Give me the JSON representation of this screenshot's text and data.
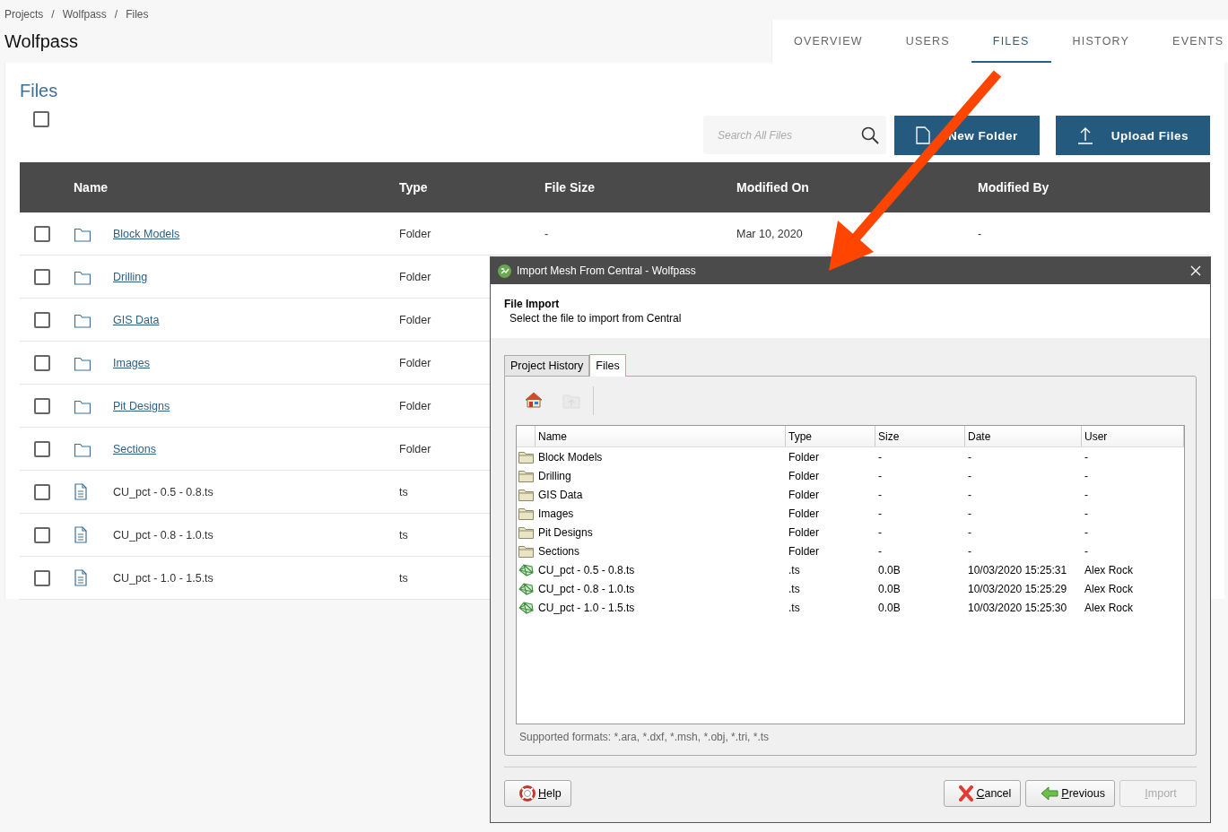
{
  "breadcrumb": {
    "items": [
      "Projects",
      "Wolfpass",
      "Files"
    ],
    "separators": [
      "/",
      "/"
    ]
  },
  "project_title": "Wolfpass",
  "tabs": [
    {
      "label": "OVERVIEW",
      "selected": false
    },
    {
      "label": "USERS",
      "selected": false
    },
    {
      "label": "FILES",
      "selected": true
    },
    {
      "label": "HISTORY",
      "selected": false
    },
    {
      "label": "EVENTS",
      "selected": false
    }
  ],
  "files_panel": {
    "title": "Files",
    "select_all": {
      "checked": false
    },
    "search": {
      "placeholder": "Search All Files"
    },
    "buttons": [
      {
        "label": "New Folder",
        "kind": "new-folder"
      },
      {
        "label": "Upload Files",
        "kind": "upload"
      }
    ],
    "table": {
      "columns": [
        "Name",
        "Type",
        "File Size",
        "Modified On",
        "Modified By"
      ],
      "rows": [
        {
          "checked": false,
          "kind": "folder",
          "name": "Block Models",
          "type": "Folder",
          "file_size": "-",
          "modified_on": "Mar 10, 2020",
          "modified_by": "-"
        },
        {
          "checked": false,
          "kind": "folder",
          "name": "Drilling",
          "type": "Folder"
        },
        {
          "checked": false,
          "kind": "folder",
          "name": "GIS Data",
          "type": "Folder"
        },
        {
          "checked": false,
          "kind": "folder",
          "name": "Images",
          "type": "Folder"
        },
        {
          "checked": false,
          "kind": "folder",
          "name": "Pit Designs",
          "type": "Folder"
        },
        {
          "checked": false,
          "kind": "folder",
          "name": "Sections",
          "type": "Folder"
        },
        {
          "checked": false,
          "kind": "file",
          "name": "CU_pct - 0.5 - 0.8.ts",
          "type": "ts"
        },
        {
          "checked": false,
          "kind": "file",
          "name": "CU_pct - 0.8 - 1.0.ts",
          "type": "ts"
        },
        {
          "checked": false,
          "kind": "file",
          "name": "CU_pct - 1.0 - 1.5.ts",
          "type": "ts"
        }
      ]
    }
  },
  "dialog": {
    "title": "Import Mesh From Central - Wolfpass",
    "heading": "File Import",
    "subtitle": "Select the file to import from Central",
    "tabs": [
      {
        "label": "Project History",
        "selected": false
      },
      {
        "label": "Files",
        "selected": true
      }
    ],
    "toolbar": [
      {
        "kind": "home",
        "disabled": false
      },
      {
        "kind": "up",
        "disabled": true
      }
    ],
    "list": {
      "columns": [
        "Name",
        "Type",
        "Size",
        "Date",
        "User"
      ],
      "rows": [
        {
          "kind": "folder",
          "name": "Block Models",
          "type": "Folder",
          "size": "-",
          "date": "-",
          "user": "-"
        },
        {
          "kind": "folder",
          "name": "Drilling",
          "type": "Folder",
          "size": "-",
          "date": "-",
          "user": "-"
        },
        {
          "kind": "folder",
          "name": "GIS Data",
          "type": "Folder",
          "size": "-",
          "date": "-",
          "user": "-"
        },
        {
          "kind": "folder",
          "name": "Images",
          "type": "Folder",
          "size": "-",
          "date": "-",
          "user": "-"
        },
        {
          "kind": "folder",
          "name": "Pit Designs",
          "type": "Folder",
          "size": "-",
          "date": "-",
          "user": "-"
        },
        {
          "kind": "folder",
          "name": "Sections",
          "type": "Folder",
          "size": "-",
          "date": "-",
          "user": "-"
        },
        {
          "kind": "mesh",
          "name": "CU_pct - 0.5 - 0.8.ts",
          "type": ".ts",
          "size": "0.0B",
          "date": "10/03/2020 15:25:31",
          "user": "Alex Rock"
        },
        {
          "kind": "mesh",
          "name": "CU_pct - 0.8 - 1.0.ts",
          "type": ".ts",
          "size": "0.0B",
          "date": "10/03/2020 15:25:29",
          "user": "Alex Rock"
        },
        {
          "kind": "mesh",
          "name": "CU_pct - 1.0 - 1.5.ts",
          "type": ".ts",
          "size": "0.0B",
          "date": "10/03/2020 15:25:30",
          "user": "Alex Rock"
        }
      ]
    },
    "formats": "Supported formats: *.ara, *.dxf, *.msh, *.obj, *.tri, *.ts",
    "buttons": [
      {
        "label": "Help",
        "kind": "help",
        "mnemonic": true,
        "disabled": false
      },
      {
        "label": "Cancel",
        "kind": "cancel",
        "mnemonic": true,
        "disabled": false
      },
      {
        "label": "Previous",
        "kind": "previous",
        "mnemonic": true,
        "disabled": false
      },
      {
        "label": "Import",
        "kind": "import",
        "mnemonic": true,
        "disabled": true
      }
    ]
  }
}
